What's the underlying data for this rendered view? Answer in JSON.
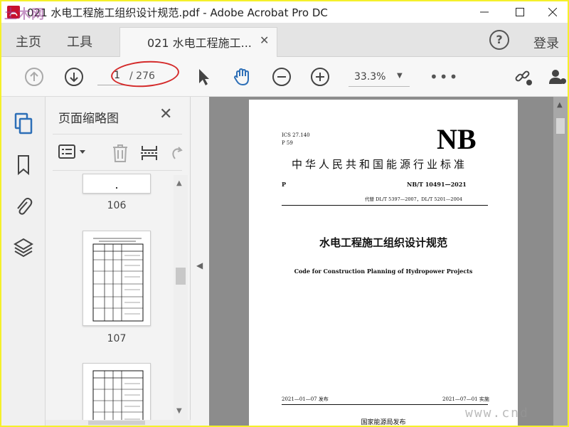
{
  "window": {
    "title": "021 水电工程施工组织设计规范.pdf - Adobe Acrobat Pro DC"
  },
  "tabs": {
    "home": "主页",
    "tools": "工具",
    "document": "021 水电工程施工...",
    "help": "?",
    "login": "登录"
  },
  "toolbar": {
    "current_page": "1",
    "total_pages": "/ 276",
    "zoom": "33.3%"
  },
  "thumbnails": {
    "title": "页面缩略图",
    "pages": [
      {
        "label": "106"
      },
      {
        "label": "107"
      }
    ]
  },
  "document": {
    "ics": "ICS 27.140",
    "p_code": "P 59",
    "logo": "NB",
    "standard_name": "中华人民共和国能源行业标准",
    "p_mark": "P",
    "standard_number": "NB/T 10491—2021",
    "replaces": "代替 DL/T  5397—2007，DL/T  5201—2004",
    "title_cn": "水电工程施工组织设计规范",
    "title_en": "Code for Construction Planning of Hydropower Projects",
    "release_date": "2021—01—07 发布",
    "effective_date": "2021—07—01 实施",
    "issuer": "国家能源局发布"
  },
  "watermarks": {
    "top_left": "土木网",
    "bottom_right": "www.cnd"
  },
  "colors": {
    "frame_border": "#f5f02a",
    "accent_blue": "#2d6fb7",
    "annotation_red": "#d42a2a"
  }
}
